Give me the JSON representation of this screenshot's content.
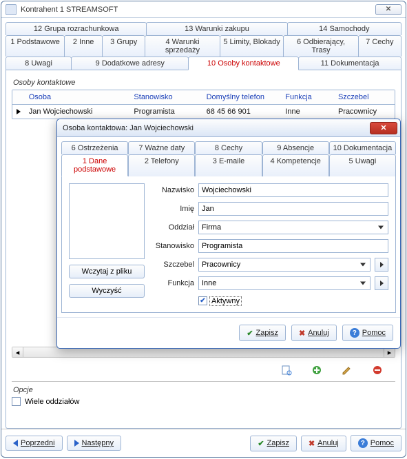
{
  "window": {
    "title": "Kontrahent  1  STREAMSOFT"
  },
  "tabs_row1": [
    {
      "label": "12 Grupa rozrachunkowa"
    },
    {
      "label": "13 Warunki zakupu"
    },
    {
      "label": "14 Samochody"
    }
  ],
  "tabs_row2": [
    {
      "label": "1 Podstawowe"
    },
    {
      "label": "2 Inne"
    },
    {
      "label": "3 Grupy"
    },
    {
      "label": "4 Warunki sprzedaży"
    },
    {
      "label": "5 Limity, Blokady"
    },
    {
      "label": "6 Odbierający, Trasy"
    },
    {
      "label": "7 Cechy"
    }
  ],
  "tabs_row3": [
    {
      "label": "8 Uwagi"
    },
    {
      "label": "9 Dodatkowe adresy"
    },
    {
      "label": "10 Osoby kontaktowe",
      "active": true
    },
    {
      "label": "11 Dokumentacja"
    }
  ],
  "section_title": "Osoby kontaktowe",
  "grid": {
    "headers": {
      "osoba": "Osoba",
      "stanowisko": "Stanowisko",
      "telefon": "Domyślny telefon",
      "funkcja": "Funkcja",
      "szczebel": "Szczebel"
    },
    "row": {
      "osoba": "Jan Wojciechowski",
      "stanowisko": "Programista",
      "telefon": "68 45 66 901",
      "funkcja": "Inne",
      "szczebel": "Pracownicy"
    }
  },
  "options": {
    "title": "Opcje",
    "checkbox": "Wiele oddziałów",
    "checked": false
  },
  "footer": {
    "prev": "Poprzedni",
    "next": "Następny",
    "save": "Zapisz",
    "cancel": "Anuluj",
    "help": "Pomoc"
  },
  "dialog": {
    "title": "Osoba kontaktowa: Jan Wojciechowski",
    "tabs_row1": [
      {
        "label": "6 Ostrzeżenia"
      },
      {
        "label": "7 Ważne daty"
      },
      {
        "label": "8 Cechy"
      },
      {
        "label": "9 Absencje"
      },
      {
        "label": "10 Dokumentacja"
      }
    ],
    "tabs_row2": [
      {
        "label": "1 Dane podstawowe",
        "active": true
      },
      {
        "label": "2 Telefony"
      },
      {
        "label": "3 E-maile"
      },
      {
        "label": "4 Kompetencje"
      },
      {
        "label": "5 Uwagi"
      }
    ],
    "buttons": {
      "load": "Wczytaj z pliku",
      "clear": "Wyczyść"
    },
    "form": {
      "nazwisko": {
        "label": "Nazwisko",
        "value": "Wojciechowski"
      },
      "imie": {
        "label": "Imię",
        "value": "Jan"
      },
      "oddzial": {
        "label": "Oddział",
        "value": "Firma"
      },
      "stanowisko": {
        "label": "Stanowisko",
        "value": "Programista"
      },
      "szczebel": {
        "label": "Szczebel",
        "value": "Pracownicy"
      },
      "funkcja": {
        "label": "Funkcja",
        "value": "Inne"
      },
      "aktywny": {
        "label": "Aktywny",
        "checked": true
      }
    },
    "footer": {
      "save": "Zapisz",
      "cancel": "Anuluj",
      "help": "Pomoc"
    }
  }
}
